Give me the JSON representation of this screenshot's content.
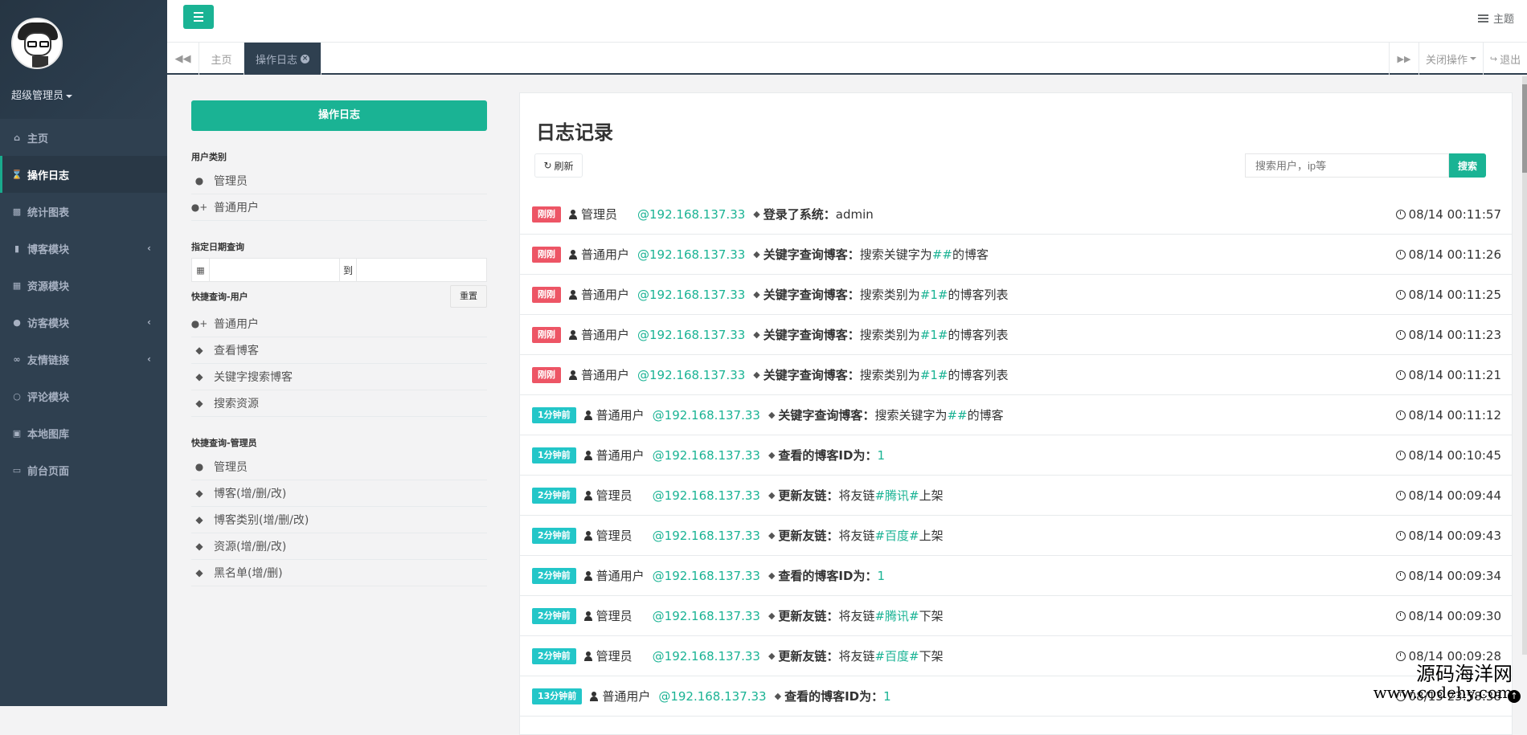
{
  "sidebar": {
    "profile_name": "超级管理员",
    "items": [
      {
        "label": "主页",
        "icon": "home-icon",
        "active": false,
        "expandable": false
      },
      {
        "label": "操作日志",
        "icon": "hourglass-icon",
        "active": true,
        "expandable": false
      },
      {
        "label": "统计图表",
        "icon": "bar-chart-icon",
        "active": false,
        "expandable": false
      },
      {
        "label": "博客模块",
        "icon": "book-icon",
        "active": false,
        "expandable": true
      },
      {
        "label": "资源模块",
        "icon": "table-icon",
        "active": false,
        "expandable": false
      },
      {
        "label": "访客模块",
        "icon": "user-icon",
        "active": false,
        "expandable": true
      },
      {
        "label": "友情链接",
        "icon": "link-icon",
        "active": false,
        "expandable": true
      },
      {
        "label": "评论模块",
        "icon": "comment-icon",
        "active": false,
        "expandable": false
      },
      {
        "label": "本地图库",
        "icon": "picture-icon",
        "active": false,
        "expandable": false
      },
      {
        "label": "前台页面",
        "icon": "desktop-icon",
        "active": false,
        "expandable": false
      }
    ]
  },
  "topbar": {
    "theme_label": "主题"
  },
  "tabs": {
    "home": "主页",
    "active": "操作日志",
    "close_ops": "关闭操作",
    "logout": "退出"
  },
  "left": {
    "header_button": "操作日志",
    "user_type_title": "用户类别",
    "user_types": [
      "管理员",
      "普通用户"
    ],
    "date_title": "指定日期查询",
    "date_to": "到",
    "reset": "重置",
    "quick_user_title": "快捷查询-用户",
    "quick_user": [
      {
        "label": "普通用户",
        "icon": "user-plus-icon"
      },
      {
        "label": "查看博客",
        "icon": "tag-icon"
      },
      {
        "label": "关键字搜索博客",
        "icon": "tag-icon"
      },
      {
        "label": "搜索资源",
        "icon": "tag-icon"
      }
    ],
    "quick_admin_title": "快捷查询-管理员",
    "quick_admin": [
      {
        "label": "管理员",
        "icon": "user-icon"
      },
      {
        "label": "博客(增/删/改)",
        "icon": "tag-icon"
      },
      {
        "label": "博客类别(增/删/改)",
        "icon": "tag-icon"
      },
      {
        "label": "资源(增/删/改)",
        "icon": "tag-icon"
      },
      {
        "label": "黑名单(增/删)",
        "icon": "tag-icon"
      }
    ]
  },
  "panel": {
    "title": "日志记录",
    "refresh": "刷新",
    "search_placeholder": "搜索用户，ip等",
    "search_button": "搜索"
  },
  "logs": [
    {
      "badge": "刚刚",
      "badge_color": "#ed5565",
      "user": "管理员",
      "ip": "@192.168.137.33",
      "action": "登录了系统",
      "pre": "admin",
      "hl": "",
      "post": "",
      "time": "08/14 00:11:57"
    },
    {
      "badge": "刚刚",
      "badge_color": "#ed5565",
      "user": "普通用户",
      "ip": "@192.168.137.33",
      "action": "关键字查询博客",
      "pre": "搜索关键字为",
      "hl": "##",
      "post": "的博客",
      "time": "08/14 00:11:26"
    },
    {
      "badge": "刚刚",
      "badge_color": "#ed5565",
      "user": "普通用户",
      "ip": "@192.168.137.33",
      "action": "关键字查询博客",
      "pre": "搜索类别为",
      "hl": "#1#",
      "post": "的博客列表",
      "time": "08/14 00:11:25"
    },
    {
      "badge": "刚刚",
      "badge_color": "#ed5565",
      "user": "普通用户",
      "ip": "@192.168.137.33",
      "action": "关键字查询博客",
      "pre": "搜索类别为",
      "hl": "#1#",
      "post": "的博客列表",
      "time": "08/14 00:11:23"
    },
    {
      "badge": "刚刚",
      "badge_color": "#ed5565",
      "user": "普通用户",
      "ip": "@192.168.137.33",
      "action": "关键字查询博客",
      "pre": "搜索类别为",
      "hl": "#1#",
      "post": "的博客列表",
      "time": "08/14 00:11:21"
    },
    {
      "badge": "1分钟前",
      "badge_color": "#23c6c8",
      "user": "普通用户",
      "ip": "@192.168.137.33",
      "action": "关键字查询博客",
      "pre": "搜索关键字为",
      "hl": "##",
      "post": "的博客",
      "time": "08/14 00:11:12"
    },
    {
      "badge": "1分钟前",
      "badge_color": "#23c6c8",
      "user": "普通用户",
      "ip": "@192.168.137.33",
      "action": "查看的博客ID为",
      "pre": "",
      "hl": "1",
      "post": "",
      "time": "08/14 00:10:45"
    },
    {
      "badge": "2分钟前",
      "badge_color": "#23c6c8",
      "user": "管理员",
      "ip": "@192.168.137.33",
      "action": "更新友链",
      "pre": "将友链",
      "hl": "#腾讯#",
      "post": "上架",
      "time": "08/14 00:09:44"
    },
    {
      "badge": "2分钟前",
      "badge_color": "#23c6c8",
      "user": "管理员",
      "ip": "@192.168.137.33",
      "action": "更新友链",
      "pre": "将友链",
      "hl": "#百度#",
      "post": "上架",
      "time": "08/14 00:09:43"
    },
    {
      "badge": "2分钟前",
      "badge_color": "#23c6c8",
      "user": "普通用户",
      "ip": "@192.168.137.33",
      "action": "查看的博客ID为",
      "pre": "",
      "hl": "1",
      "post": "",
      "time": "08/14 00:09:34"
    },
    {
      "badge": "2分钟前",
      "badge_color": "#23c6c8",
      "user": "管理员",
      "ip": "@192.168.137.33",
      "action": "更新友链",
      "pre": "将友链",
      "hl": "#腾讯#",
      "post": "下架",
      "time": "08/14 00:09:30"
    },
    {
      "badge": "2分钟前",
      "badge_color": "#23c6c8",
      "user": "管理员",
      "ip": "@192.168.137.33",
      "action": "更新友链",
      "pre": "将友链",
      "hl": "#百度#",
      "post": "下架",
      "time": "08/14 00:09:28"
    },
    {
      "badge": "13分钟前",
      "badge_color": "#23c6c8",
      "user": "普通用户",
      "ip": "@192.168.137.33",
      "action": "查看的博客ID为",
      "pre": "",
      "hl": "1",
      "post": "",
      "time": "08/13 23:58:38"
    }
  ],
  "watermark": {
    "line1": "源码海洋网",
    "line2": "www.codehy.com"
  }
}
